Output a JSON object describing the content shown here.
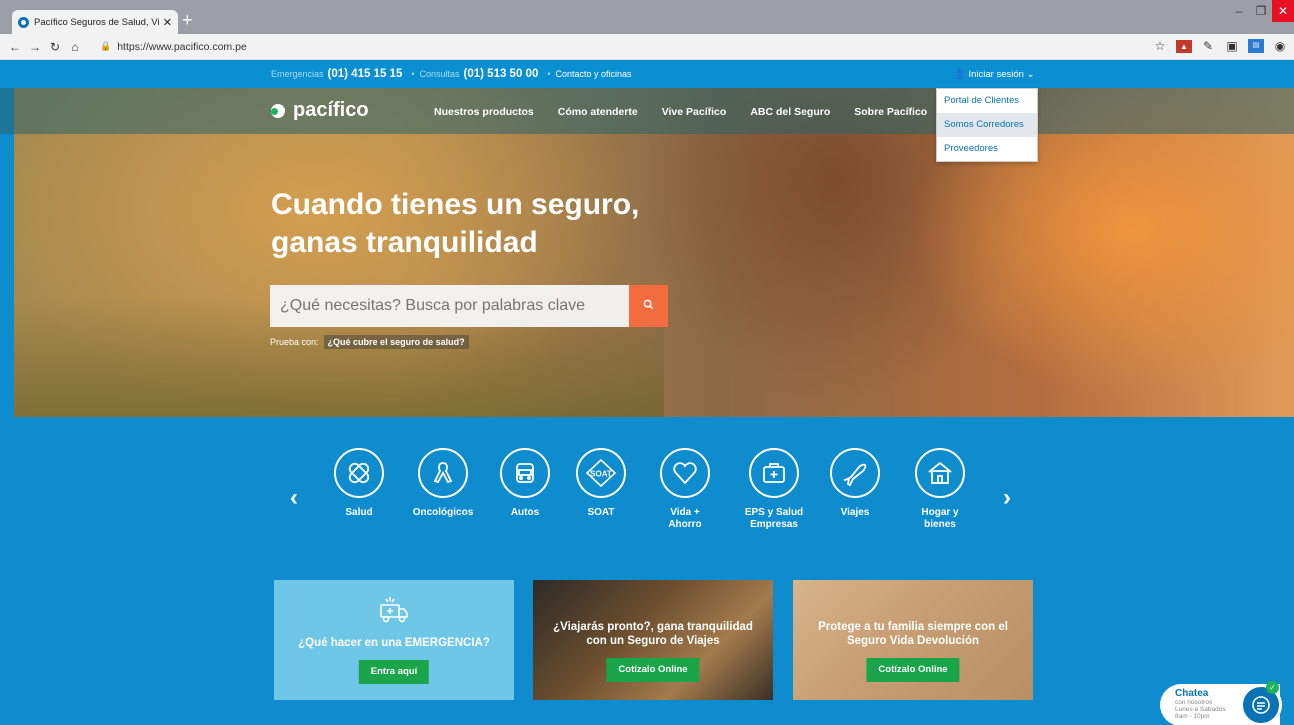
{
  "browser": {
    "tab_title": "Pacífico Seguros de Salud, Vida, ·",
    "tab_close": "✕",
    "new_tab": "+",
    "url": "https://www.pacifico.com.pe",
    "win_min": "–",
    "win_restore": "❐",
    "win_close": "✕"
  },
  "topbar": {
    "emergencias_label": "Emergencias",
    "emergencias_phone": "(01) 415 15 15",
    "consultas_label": "Consultas",
    "consultas_phone": "(01) 513 50 00",
    "contacto": "Contacto y oficinas",
    "separator": "•",
    "login": "Iniciar sesión"
  },
  "login_menu": [
    "Portal de Clientes",
    "Somos Corredores",
    "Proveedores"
  ],
  "nav": {
    "logo": "pacífico",
    "links": [
      "Nuestros productos",
      "Cómo atenderte",
      "Vive Pacífico",
      "ABC del Seguro",
      "Sobre Pacífico"
    ]
  },
  "hero": {
    "headline_line1": "Cuando tienes un seguro,",
    "headline_line2": "ganas tranquilidad",
    "search_placeholder": "¿Qué necesitas? Busca por palabras clave",
    "try_label": "Prueba con:",
    "try_suggestion": "¿Qué cubre el seguro de salud?"
  },
  "categories": [
    {
      "label": "Salud",
      "icon": "bandage-icon"
    },
    {
      "label": "Oncológicos",
      "icon": "ribbon-icon"
    },
    {
      "label": "Autos",
      "icon": "car-icon"
    },
    {
      "label": "SOAT",
      "icon": "soat-icon"
    },
    {
      "label": "Vida +\nAhorro",
      "icon": "heart-icon"
    },
    {
      "label": "EPS y Salud\nEmpresas",
      "icon": "medical-kit-icon"
    },
    {
      "label": "Viajes",
      "icon": "plane-icon"
    },
    {
      "label": "Hogar y\nbienes",
      "icon": "house-icon"
    }
  ],
  "cards": [
    {
      "title": "¿Qué hacer en una EMERGENCIA?",
      "button": "Entra aquí"
    },
    {
      "title": "¿Viajarás pronto?, gana tranquilidad con un Seguro de Viajes",
      "button": "Cotízalo Online"
    },
    {
      "title": "Protege a tu familia siempre con el Seguro Vida Devolución",
      "button": "Cotízalo Online"
    }
  ],
  "chat": {
    "title": "Chatea",
    "subtitle": "con nosotros",
    "hours1": "Lunes a Sábados",
    "hours2": "8am - 10pm"
  },
  "colors": {
    "brand_blue": "#0a8fd0",
    "brand_green": "#1aa54a",
    "search_orange": "#f26c3f"
  }
}
